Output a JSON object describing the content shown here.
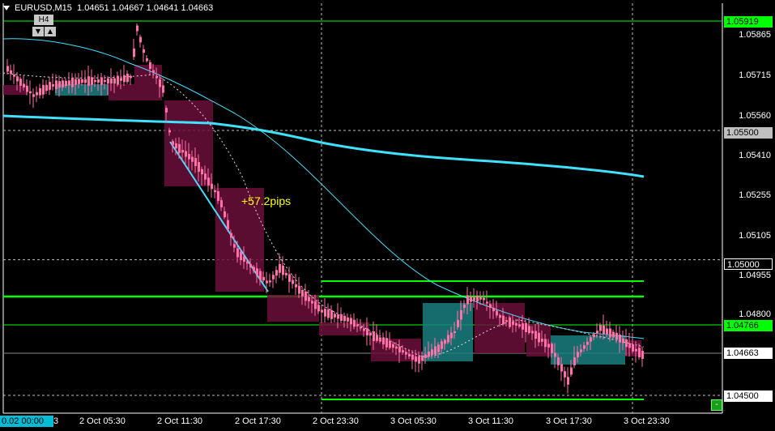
{
  "header": {
    "symbol_tf": "EURUSD,M15",
    "ohlc": "1.04651 1.04667 1.04641 1.04663"
  },
  "timeframe_widget": {
    "label": "H4",
    "down_icon": "triangle-down-icon",
    "up_icon": "triangle-up-icon"
  },
  "annotation": {
    "pips_text": "+57.2pips"
  },
  "price_axis": {
    "ticks": [
      "1.05865",
      "1.05715",
      "1.05560",
      "1.05410",
      "1.05255",
      "1.05105",
      "1.04955",
      "1.04800"
    ],
    "levels": [
      {
        "value": "1.05919",
        "bg": "#00ff00",
        "fg": "#000000"
      },
      {
        "value": "1.05500",
        "bg": "#c0c0c0",
        "fg": "#000000"
      },
      {
        "value": "1.05000",
        "bg": "#000000",
        "fg": "#ffffff"
      },
      {
        "value": "1.04766",
        "bg": "#00ff00",
        "fg": "#000000"
      },
      {
        "value": "1.04663",
        "bg": "#ffffff",
        "fg": "#000000"
      },
      {
        "value": "1.04500",
        "bg": "#ffffff",
        "fg": "#000000"
      }
    ]
  },
  "time_axis": {
    "first_label": "0.02 00:00",
    "first_suffix": "3",
    "labels": [
      "2 Oct 05:30",
      "2 Oct 11:30",
      "2 Oct 17:30",
      "2 Oct 23:30",
      "3 Oct 05:30",
      "3 Oct 11:30",
      "3 Oct 17:30",
      "3 Oct 23:30"
    ]
  },
  "controls": {
    "minus_label": "-"
  },
  "colors": {
    "background": "#000000",
    "bull_candle": "#ff6fa8",
    "bear_candle": "#ff6fa8",
    "ma_slow": "#40e0ff",
    "ma_fast": "#40e0ff",
    "level_green": "#00ff00",
    "box_maroon": "#6b0f3a",
    "box_teal": "#1a7f7f"
  }
}
